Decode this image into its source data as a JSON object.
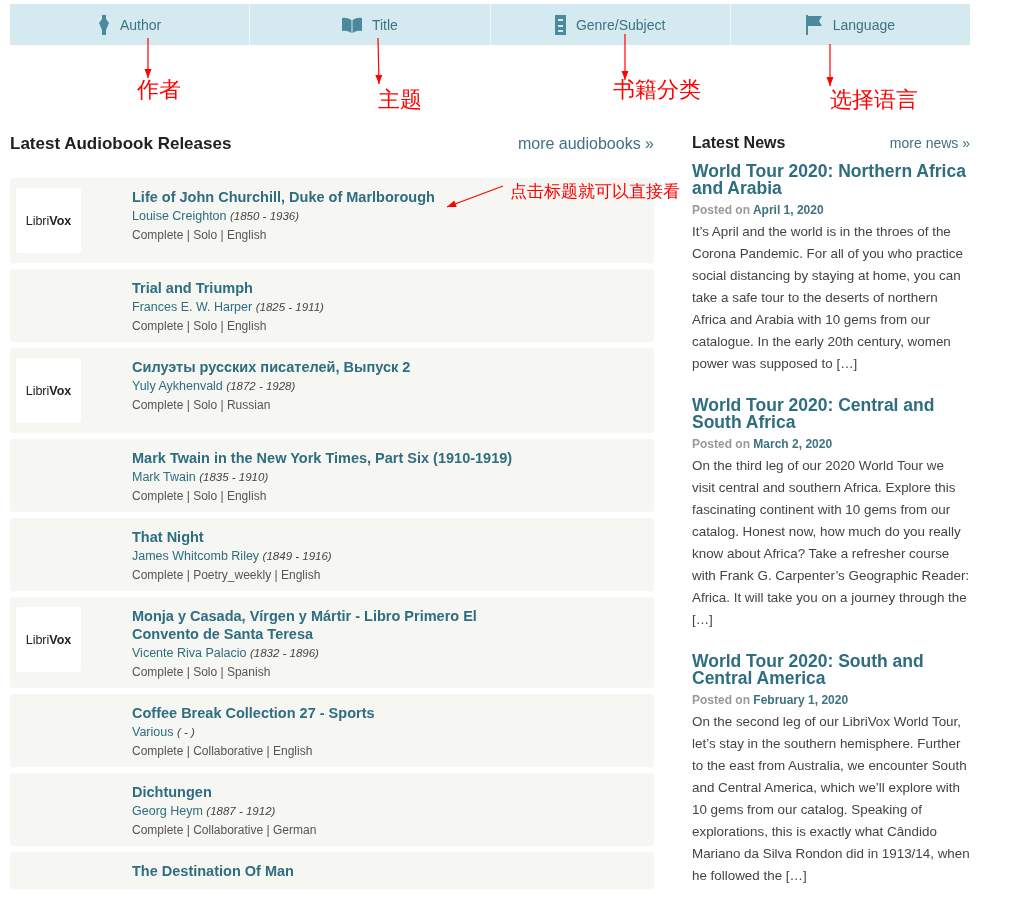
{
  "nav": [
    {
      "label": "Author",
      "kind": "pen"
    },
    {
      "label": "Title",
      "kind": "book"
    },
    {
      "label": "Genre/Subject",
      "kind": "cabinet"
    },
    {
      "label": "Language",
      "kind": "flag"
    }
  ],
  "annotations": [
    "作者",
    "主题",
    "书籍分类",
    "选择语言",
    "点击标题就可以直接看"
  ],
  "releases": {
    "heading": "Latest Audiobook Releases",
    "more": "more audiobooks »",
    "books": [
      {
        "thumbnail": "Libri**Vox**",
        "title": "Life of John Churchill, Duke of Marlborough",
        "author": "Louise Creighton",
        "dates": "(1850 - 1936)",
        "meta": "Complete | Solo | English"
      },
      {
        "title": "Trial and Triumph",
        "author": "Frances E. W. Harper",
        "dates": "(1825 - 1911)",
        "meta": "Complete | Solo | English"
      },
      {
        "thumbnail": "Libri**Vox**",
        "title": "Силуэты русских писателей, Выпуск 2",
        "author": "Yuly Aykhenvald",
        "dates": "(1872 - 1928)",
        "meta": "Complete | Solo | Russian"
      },
      {
        "title": "Mark Twain in the New York Times, Part Six (1910-1919)",
        "author": "Mark Twain",
        "dates": "(1835 - 1910)",
        "meta": "Complete | Solo | English"
      },
      {
        "title": "That Night",
        "author": "James Whitcomb Riley",
        "dates": "(1849 - 1916)",
        "meta": "Complete | Poetry_weekly | English"
      },
      {
        "thumbnail": "Libri**Vox**",
        "title": "Monja y Casada, Vírgen y Mártir - Libro Primero El Convento de Santa Teresa",
        "author": "Vicente Riva Palacio",
        "dates": "(1832 - 1896)",
        "meta": "Complete | Solo | Spanish"
      },
      {
        "title": "Coffee Break Collection 27 - Sports",
        "author": "Various",
        "dates": "( - )",
        "meta": "Complete | Collaborative | English"
      },
      {
        "title": "Dichtungen",
        "author": "Georg Heym",
        "dates": "(1887 - 1912)",
        "meta": "Complete | Collaborative | German"
      },
      {
        "title": "The Destination Of Man"
      }
    ]
  },
  "news": {
    "heading": "Latest News",
    "more": "more news »",
    "posts": [
      {
        "title": "World Tour 2020: Northern Africa and Arabia",
        "posted": "Posted on",
        "date": "April 1, 2020",
        "body": "It’s April and the world is in the throes of the Corona Pandemic. For all of you who practice social distancing by staying at home, you can take a safe tour to the deserts of northern Africa and Arabia with 10 gems from our catalogue. In the early 20th century, women power was supposed to […]"
      },
      {
        "title": "World Tour 2020: Central and South Africa",
        "posted": "Posted on",
        "date": "March 2, 2020",
        "body": "On the third leg of our 2020 World Tour we visit central and southern Africa. Explore this fascinating continent with 10 gems from our catalog. Honest now, how much do you really know about Africa? Take a refresher course with Frank G. Carpenter’s Geographic Reader: Africa. It will take you on a journey through the […]"
      },
      {
        "title": "World Tour 2020: South and Central America",
        "posted": "Posted on",
        "date": "February 1, 2020",
        "body": "On the second leg of our LibriVox World Tour, let’s stay in the southern hemisphere. Further to the east from Australia, we encounter South and Central America, which we’ll explore with 10 gems from our catalog. Speaking of explorations, this is exactly what Cândido Mariano da Silva Rondon did in 1913/14, when he followed the […]"
      }
    ]
  }
}
